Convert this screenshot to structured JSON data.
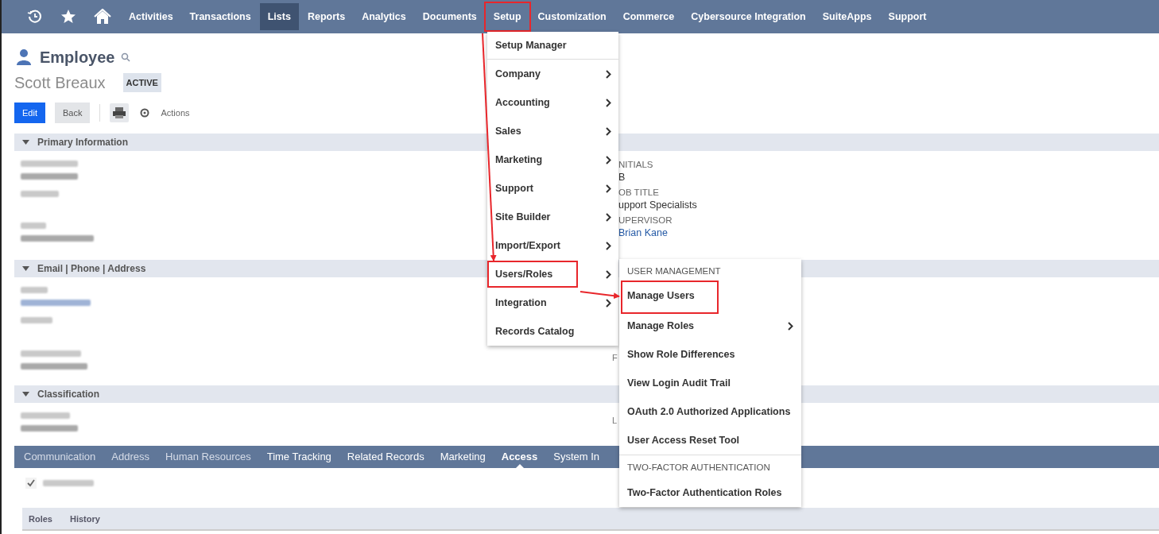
{
  "nav": [
    {
      "label": "Activities",
      "selected": false,
      "highlighted": false
    },
    {
      "label": "Transactions",
      "selected": false,
      "highlighted": false
    },
    {
      "label": "Lists",
      "selected": true,
      "highlighted": false
    },
    {
      "label": "Reports",
      "selected": false,
      "highlighted": false
    },
    {
      "label": "Analytics",
      "selected": false,
      "highlighted": false
    },
    {
      "label": "Documents",
      "selected": false,
      "highlighted": false
    },
    {
      "label": "Setup",
      "selected": false,
      "highlighted": true
    },
    {
      "label": "Customization",
      "selected": false,
      "highlighted": false
    },
    {
      "label": "Commerce",
      "selected": false,
      "highlighted": false
    },
    {
      "label": "Cybersource Integration",
      "selected": false,
      "highlighted": false
    },
    {
      "label": "SuiteApps",
      "selected": false,
      "highlighted": false
    },
    {
      "label": "Support",
      "selected": false,
      "highlighted": false
    }
  ],
  "record": {
    "type": "Employee",
    "name": "Scott Breaux",
    "status": "ACTIVE",
    "buttons": [
      "Edit",
      "Back"
    ],
    "actions": "Actions"
  },
  "sections": [
    {
      "title": "Primary Information",
      "right_fields": [
        {
          "label": "NITIALS",
          "value": "B",
          "link": false
        },
        {
          "label": "OB TITLE",
          "value": "upport Specialists",
          "link": false
        },
        {
          "label": "UPERVISOR",
          "value": "Brian Kane",
          "link": true
        }
      ]
    },
    {
      "title": "Email | Phone | Address",
      "fragment": "F"
    },
    {
      "title": "Classification",
      "fragment": "L"
    }
  ],
  "subtabs": [
    {
      "label": "Communication",
      "selected": false
    },
    {
      "label": "Address",
      "selected": false
    },
    {
      "label": "Human Resources",
      "selected": false
    },
    {
      "label": "Time Tracking",
      "selected": false
    },
    {
      "label": "Related Records",
      "selected": false
    },
    {
      "label": "Marketing",
      "selected": false
    },
    {
      "label": "Access",
      "selected": true
    },
    {
      "label": "System In",
      "selected": false
    }
  ],
  "give_access": {
    "checked": true
  },
  "sublist_tabs": [
    "Roles",
    "History"
  ],
  "setup_menu": [
    {
      "label": "Setup Manager",
      "submenu": false,
      "divider_after": true,
      "highlighted": false
    },
    {
      "label": "Company",
      "submenu": true,
      "divider_after": false,
      "highlighted": false
    },
    {
      "label": "Accounting",
      "submenu": true,
      "divider_after": false,
      "highlighted": false
    },
    {
      "label": "Sales",
      "submenu": true,
      "divider_after": false,
      "highlighted": false
    },
    {
      "label": "Marketing",
      "submenu": true,
      "divider_after": false,
      "highlighted": false
    },
    {
      "label": "Support",
      "submenu": true,
      "divider_after": false,
      "highlighted": false
    },
    {
      "label": "Site Builder",
      "submenu": true,
      "divider_after": false,
      "highlighted": false
    },
    {
      "label": "Import/Export",
      "submenu": true,
      "divider_after": false,
      "highlighted": false
    },
    {
      "label": "Users/Roles",
      "submenu": true,
      "divider_after": false,
      "highlighted": true
    },
    {
      "label": "Integration",
      "submenu": true,
      "divider_after": false,
      "highlighted": false
    },
    {
      "label": "Records Catalog",
      "submenu": false,
      "divider_after": false,
      "highlighted": false
    }
  ],
  "users_roles_menu": [
    {
      "kind": "header",
      "label": "USER MANAGEMENT"
    },
    {
      "kind": "item",
      "label": "Manage Users",
      "submenu": false,
      "highlighted": true
    },
    {
      "kind": "item",
      "label": "Manage Roles",
      "submenu": true,
      "highlighted": false
    },
    {
      "kind": "item",
      "label": "Show Role Differences",
      "submenu": false,
      "highlighted": false
    },
    {
      "kind": "item",
      "label": "View Login Audit Trail",
      "submenu": false,
      "highlighted": false
    },
    {
      "kind": "item",
      "label": "OAuth 2.0 Authorized Applications",
      "submenu": false,
      "highlighted": false
    },
    {
      "kind": "item",
      "label": "User Access Reset Tool",
      "submenu": false,
      "highlighted": false
    },
    {
      "kind": "header",
      "label": "TWO-FACTOR AUTHENTICATION"
    },
    {
      "kind": "item",
      "label": "Two-Factor Authentication Roles",
      "submenu": false,
      "highlighted": false
    }
  ]
}
